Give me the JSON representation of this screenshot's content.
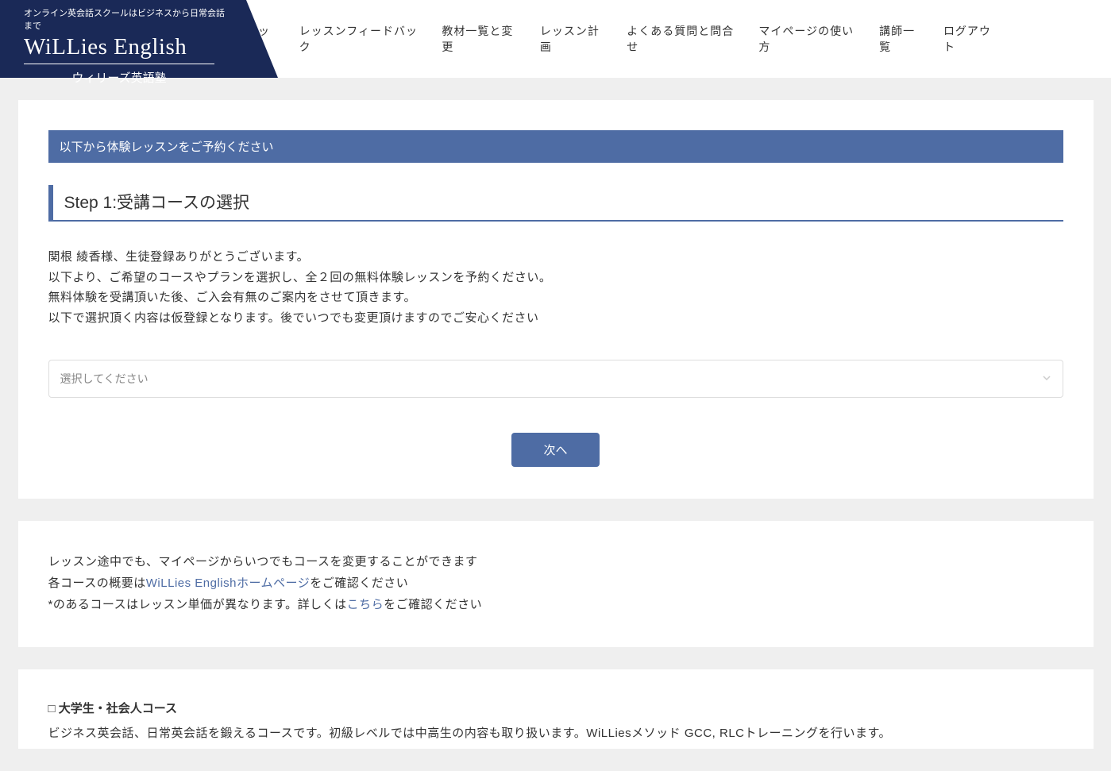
{
  "logo": {
    "tagline": "オンライン英会話スクールはビジネスから日常会話まで",
    "main": "WiLLies English",
    "sub": "ウィリーズ英語塾"
  },
  "nav": {
    "top": "トップ",
    "feedback": "レッスンフィードバック",
    "materials": "教材一覧と変更",
    "plan": "レッスン計画",
    "faq": "よくある質問と問合せ",
    "mypage": "マイページの使い方",
    "tutors": "講師一覧",
    "logout": "ログアウト"
  },
  "banner": "以下から体験レッスンをご予約ください",
  "step_heading": "Step 1:受講コースの選択",
  "msg": {
    "l1": "関根 綾香様、生徒登録ありがとうございます。",
    "l2": "以下より、ご希望のコースやプランを選択し、全２回の無料体験レッスンを予約ください。",
    "l3": "無料体験を受講頂いた後、ご入会有無のご案内をさせて頂きます。",
    "l4": "以下で選択頂く内容は仮登録となります。後でいつでも変更頂けますのでご安心ください"
  },
  "select_placeholder": "選択してください",
  "next_btn": "次へ",
  "info": {
    "l1": "レッスン途中でも、マイページからいつでもコースを変更することができます",
    "l2_pre": "各コースの概要は",
    "l2_link": "WiLLies Englishホームページ",
    "l2_post": "をご確認ください",
    "l3_pre": "*のあるコースはレッスン単価が異なります。詳しくは",
    "l3_link": "こちら",
    "l3_post": "をご確認ください"
  },
  "course": {
    "title": "□ 大学生・社会人コース",
    "desc": "ビジネス英会話、日常英会話を鍛えるコースです。初級レベルでは中高生の内容も取り扱います。WiLLiesメソッド GCC, RLCトレーニングを行います。"
  }
}
